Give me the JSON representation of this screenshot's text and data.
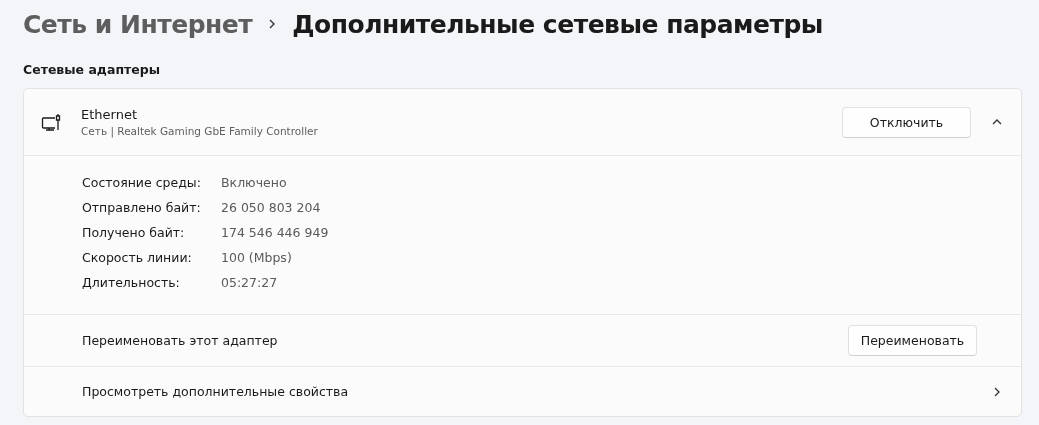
{
  "breadcrumb": [
    {
      "label": "Сеть и Интернет"
    },
    {
      "label": "Дополнительные сетевые параметры"
    }
  ],
  "section_title": "Сетевые адаптеры",
  "adapter": {
    "name": "Ethernet",
    "description": "Сеть | Realtek Gaming GbE Family Controller",
    "button": "Отключить",
    "expanded": true,
    "properties": [
      {
        "label": "Состояние среды:",
        "value": "Включено"
      },
      {
        "label": "Отправлено байт:",
        "value": "26 050 803 204"
      },
      {
        "label": "Получено байт:",
        "value": "174 546 446 949"
      },
      {
        "label": "Скорость линии:",
        "value": "100 (Mbps)"
      },
      {
        "label": "Длительность:",
        "value": "05:27:27"
      }
    ],
    "actions": [
      {
        "kind": "button",
        "label": "Переименовать этот адаптер",
        "button": "Переименовать"
      },
      {
        "kind": "link",
        "label": "Просмотреть дополнительные свойства"
      }
    ]
  }
}
